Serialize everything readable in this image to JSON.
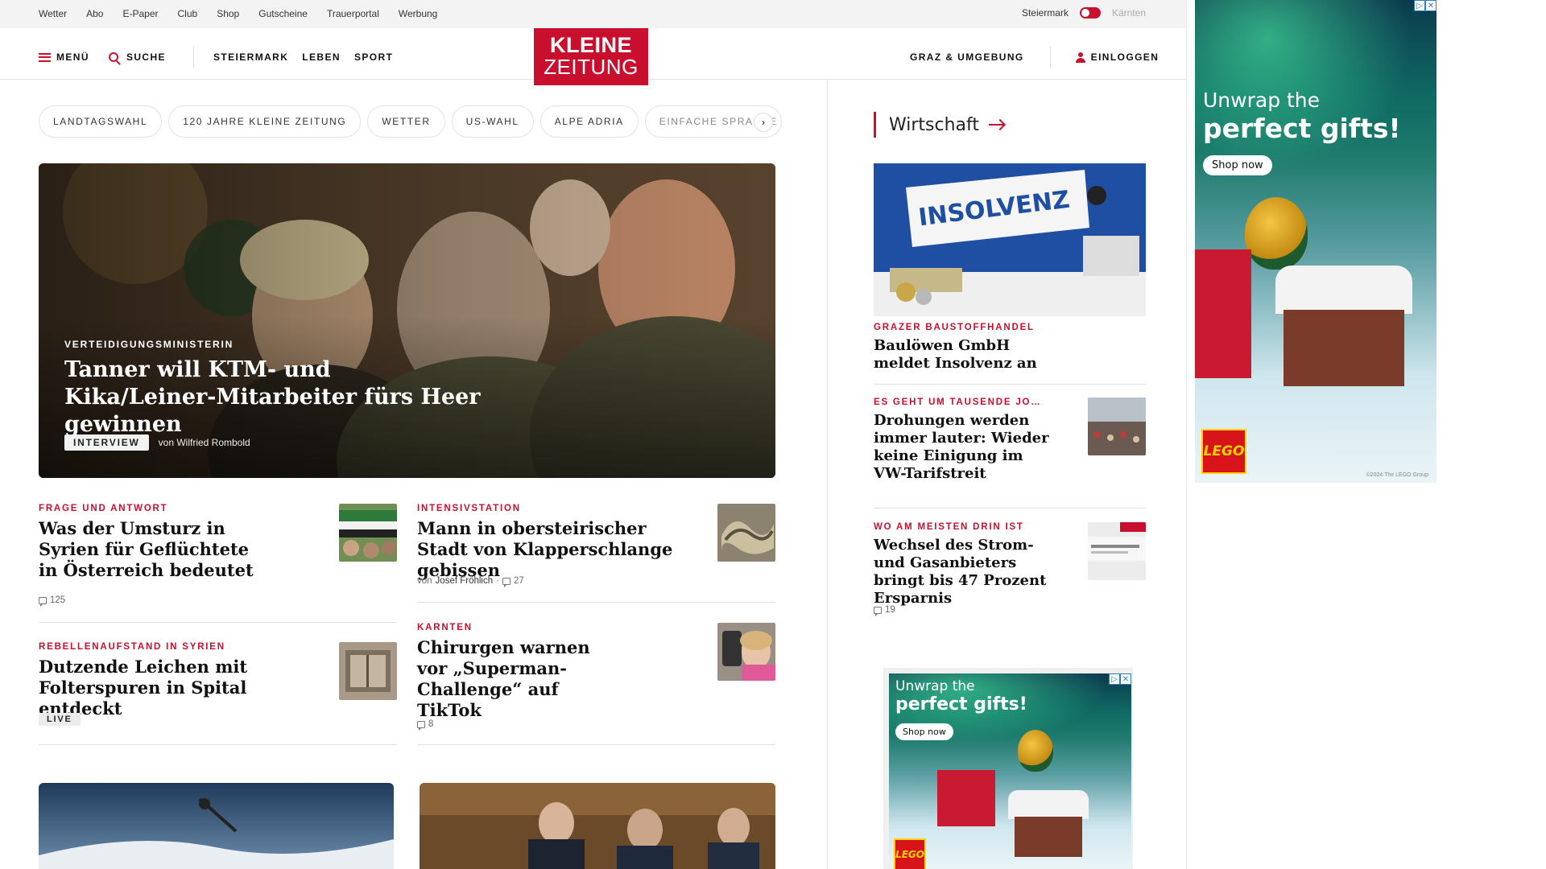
{
  "utility_bar": {
    "links": [
      "Wetter",
      "Abo",
      "E-Paper",
      "Club",
      "Shop",
      "Gutscheine",
      "Trauerportal",
      "Werbung"
    ],
    "region_active": "Steiermark",
    "region_inactive": "Kärnten"
  },
  "header": {
    "menu_label": "MENÜ",
    "search_label": "SUCHE",
    "nav": [
      "STEIERMARK",
      "LEBEN",
      "SPORT"
    ],
    "logo_line1": "KLEINE",
    "logo_line2": "ZEITUNG",
    "local_label": "GRAZ & UMGEBUNG",
    "login_label": "EINLOGGEN"
  },
  "topics": [
    "LANDTAGSWAHL",
    "120 JAHRE KLEINE ZEITUNG",
    "WETTER",
    "US-WAHL",
    "ALPE ADRIA",
    "EINFACHE SPRACHE"
  ],
  "hero": {
    "kicker": "VERTEIDIGUNGSMINISTERIN",
    "title": "Tanner will KTM- und Kika/Leiner-Mitarbeiter fürs Heer gewinnen",
    "badge": "INTERVIEW",
    "byline": "von Wilfried Rombold"
  },
  "articles": [
    {
      "kicker": "FRAGE UND ANTWORT",
      "title": "Was der Umsturz in Syrien für Geflüchtete in Österreich bedeutet",
      "comments": "125"
    },
    {
      "kicker": "INTENSIVSTATION",
      "title": "Mann in obersteirischer Stadt von Klapperschlange gebissen",
      "by_prefix": "von",
      "author": "Josef Fröhlich",
      "comments": "27"
    },
    {
      "kicker": "REBELLENAUFSTAND IN SYRIEN",
      "title": "Dutzende Leichen mit Folterspuren in Spital entdeckt",
      "badge": "LIVE"
    },
    {
      "kicker": "KÄRNTEN",
      "title": "Chirurgen warnen vor „Superman-Challenge“ auf TikTok",
      "comments": "8"
    }
  ],
  "sidebar": {
    "section_title": "Wirtschaft",
    "lead": {
      "kicker": "GRAZER BAUSTOFFHANDEL",
      "title": "Baulöwen GmbH meldet Insolvenz an",
      "image_text": "INSOLVENZ"
    },
    "items": [
      {
        "kicker": "ES GEHT UM TAUSENDE JO…",
        "title": "Drohungen werden immer lauter: Wieder keine Einigung im VW-Tarifstreit"
      },
      {
        "kicker": "WO AM MEISTEN DRIN IST",
        "title": "Wechsel des Strom- und Gasanbieters bringt bis 47 Prozent Ersparnis",
        "comments": "19"
      }
    ]
  },
  "ads": [
    {
      "line1": "Unwrap the",
      "line2": "perfect gifts!",
      "cta": "Shop now",
      "brand": "LEGO",
      "fineprint": "©2024 The LEGO Group"
    },
    {
      "line1": "Unwrap the",
      "line2": "perfect gifts!",
      "cta": "Shop now",
      "brand": "LEGO"
    }
  ],
  "colors": {
    "brand_red": "#c8102e",
    "text": "#111111",
    "muted": "#666666"
  }
}
